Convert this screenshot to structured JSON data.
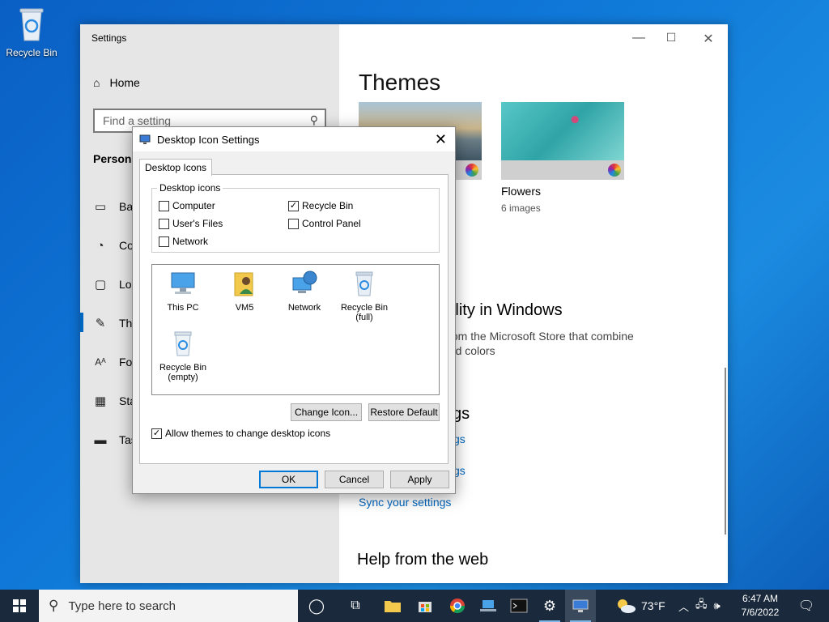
{
  "desktop": {
    "recycle_bin_label": "Recycle Bin"
  },
  "settings": {
    "window_title": "Settings",
    "home_label": "Home",
    "search_placeholder": "Find a setting",
    "section_heading": "Persona",
    "nav": [
      {
        "label": "Bac",
        "icon": "picture-icon"
      },
      {
        "label": "Co",
        "icon": "palette-icon"
      },
      {
        "label": "Loc",
        "icon": "lock-screen-icon"
      },
      {
        "label": "The",
        "icon": "themes-brush-icon"
      },
      {
        "label": "For",
        "icon": "fonts-icon"
      },
      {
        "label": "Sta",
        "icon": "start-grid-icon"
      },
      {
        "label": "Tas",
        "icon": "taskbar-icon"
      }
    ],
    "page_title": "Themes",
    "themes": [
      {
        "name": "",
        "subtitle": ""
      },
      {
        "name": "Flowers",
        "subtitle": "6 images"
      }
    ],
    "personality_heading": "sonality in Windows",
    "personality_desc_1": "mes from the Microsoft Store that combine",
    "personality_desc_2": "and colors",
    "related_heading": "gs",
    "link_1": "gs",
    "link_2": "gs",
    "sync_link": "Sync your settings",
    "help_heading": "Help from the web"
  },
  "dialog": {
    "title": "Desktop Icon Settings",
    "tab": "Desktop Icons",
    "group_label": "Desktop icons",
    "checkboxes": [
      {
        "label": "Computer",
        "checked": false
      },
      {
        "label": "Recycle Bin",
        "checked": true
      },
      {
        "label": "User's Files",
        "checked": false
      },
      {
        "label": "Control Panel",
        "checked": false
      },
      {
        "label": "Network",
        "checked": false
      }
    ],
    "icons": [
      {
        "label": "This PC",
        "sub": ""
      },
      {
        "label": "VM5",
        "sub": ""
      },
      {
        "label": "Network",
        "sub": ""
      },
      {
        "label": "Recycle Bin",
        "sub": "(full)"
      },
      {
        "label": "Recycle Bin",
        "sub": "(empty)"
      }
    ],
    "change_icon_btn": "Change Icon...",
    "restore_default_btn": "Restore Default",
    "allow_themes_label": "Allow themes to change desktop icons",
    "allow_themes_checked": true,
    "ok_btn": "OK",
    "cancel_btn": "Cancel",
    "apply_btn": "Apply"
  },
  "taskbar": {
    "search_placeholder": "Type here to search",
    "weather_temp": "73°F",
    "time": "6:47 AM",
    "date": "7/6/2022"
  },
  "colors": {
    "accent": "#0067c0",
    "taskbar": "#1a2a3c",
    "desktop": "#0f78d8"
  }
}
